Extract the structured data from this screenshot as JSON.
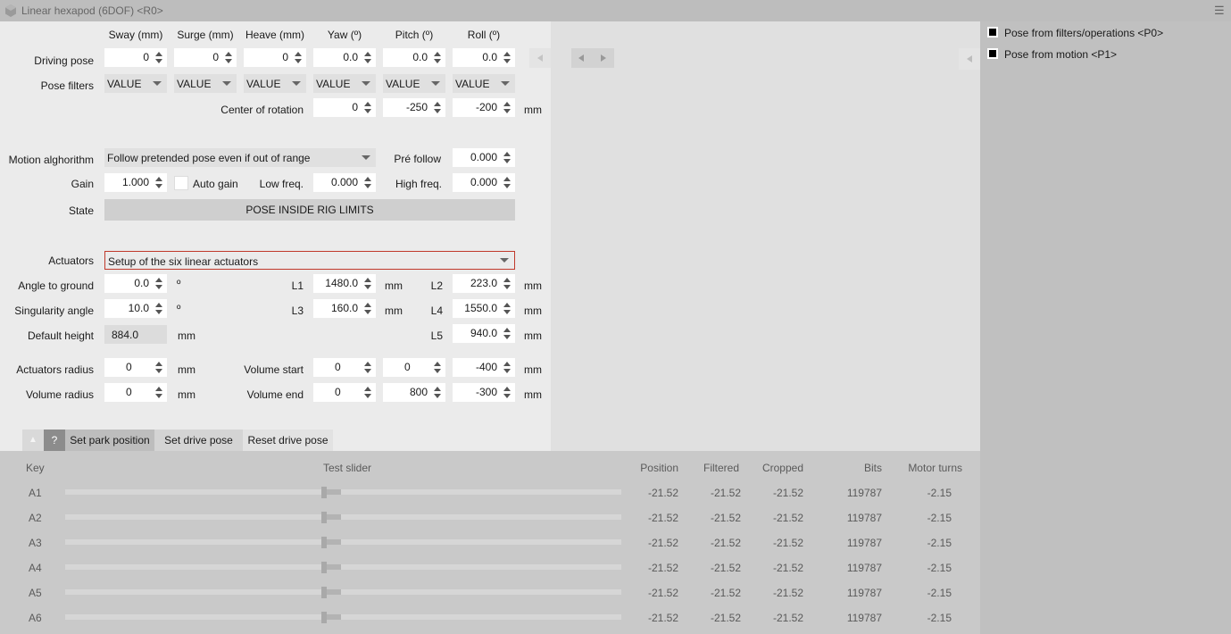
{
  "window": {
    "title": "Linear hexapod (6DOF) <R0>",
    "menu_glyph": "☰"
  },
  "pose": {
    "headers": [
      "Sway (mm)",
      "Surge (mm)",
      "Heave (mm)",
      "Yaw (º)",
      "Pitch (º)",
      "Roll (º)"
    ],
    "driving_label": "Driving pose",
    "driving_values": [
      "0",
      "0",
      "0",
      "0.0",
      "0.0",
      "0.0"
    ],
    "filters_label": "Pose filters",
    "filter_values": [
      "VALUE",
      "VALUE",
      "VALUE",
      "VALUE",
      "VALUE",
      "VALUE"
    ],
    "center_label": "Center of rotation",
    "center_values": [
      "0",
      "-250",
      "-200"
    ],
    "center_unit": "mm"
  },
  "motion": {
    "algorithm_label": "Motion alghorithm",
    "algorithm_value": "Follow pretended pose even if out of range",
    "pre_follow_label": "Pré follow",
    "pre_follow_value": "0.000",
    "gain_label": "Gain",
    "gain_value": "1.000",
    "auto_gain_label": "Auto gain",
    "low_freq_label": "Low freq.",
    "low_freq_value": "0.000",
    "high_freq_label": "High freq.",
    "high_freq_value": "0.000",
    "state_label": "State",
    "state_value": "POSE INSIDE RIG LIMITS"
  },
  "actuators": {
    "label": "Actuators",
    "value": "Setup of the six linear actuators",
    "angle_label": "Angle to ground",
    "angle_value": "0.0",
    "angle_unit": "º",
    "singularity_label": "Singularity angle",
    "singularity_value": "10.0",
    "singularity_unit": "º",
    "default_height_label": "Default height",
    "default_height_value": "884.0",
    "default_height_unit": "mm",
    "L1_label": "L1",
    "L1_value": "1480.0",
    "L1_unit": "mm",
    "L2_label": "L2",
    "L2_value": "223.0",
    "L2_unit": "mm",
    "L3_label": "L3",
    "L3_value": "160.0",
    "L3_unit": "mm",
    "L4_label": "L4",
    "L4_value": "1550.0",
    "L4_unit": "mm",
    "L5_label": "L5",
    "L5_value": "940.0",
    "L5_unit": "mm",
    "radius_label": "Actuators radius",
    "radius_value": "0",
    "radius_unit": "mm",
    "volume_radius_label": "Volume radius",
    "volume_radius_value": "0",
    "volume_radius_unit": "mm",
    "volume_start_label": "Volume start",
    "volume_start_values": [
      "0",
      "0",
      "-400"
    ],
    "volume_start_unit": "mm",
    "volume_end_label": "Volume end",
    "volume_end_values": [
      "0",
      "800",
      "-300"
    ],
    "volume_end_unit": "mm"
  },
  "tabs": {
    "collapse_glyph": "▲",
    "help_label": "?",
    "park": "Set park position",
    "drive": "Set drive pose",
    "reset": "Reset drive pose"
  },
  "outputs": {
    "labels": [
      "Pose from filters/operations <P0>",
      "Pose from motion <P1>"
    ]
  },
  "table": {
    "headers": {
      "key": "Key",
      "slider": "Test slider",
      "position": "Position",
      "filtered": "Filtered",
      "cropped": "Cropped",
      "bits": "Bits",
      "turns": "Motor turns"
    },
    "rows": [
      {
        "key": "A1",
        "slider_fraction": 0.46,
        "position": "-21.52",
        "filtered": "-21.52",
        "cropped": "-21.52",
        "bits": "119787",
        "turns": "-2.15"
      },
      {
        "key": "A2",
        "slider_fraction": 0.46,
        "position": "-21.52",
        "filtered": "-21.52",
        "cropped": "-21.52",
        "bits": "119787",
        "turns": "-2.15"
      },
      {
        "key": "A3",
        "slider_fraction": 0.46,
        "position": "-21.52",
        "filtered": "-21.52",
        "cropped": "-21.52",
        "bits": "119787",
        "turns": "-2.15"
      },
      {
        "key": "A4",
        "slider_fraction": 0.46,
        "position": "-21.52",
        "filtered": "-21.52",
        "cropped": "-21.52",
        "bits": "119787",
        "turns": "-2.15"
      },
      {
        "key": "A5",
        "slider_fraction": 0.46,
        "position": "-21.52",
        "filtered": "-21.52",
        "cropped": "-21.52",
        "bits": "119787",
        "turns": "-2.15"
      },
      {
        "key": "A6",
        "slider_fraction": 0.46,
        "position": "-21.52",
        "filtered": "-21.52",
        "cropped": "-21.52",
        "bits": "119787",
        "turns": "-2.15"
      }
    ]
  }
}
